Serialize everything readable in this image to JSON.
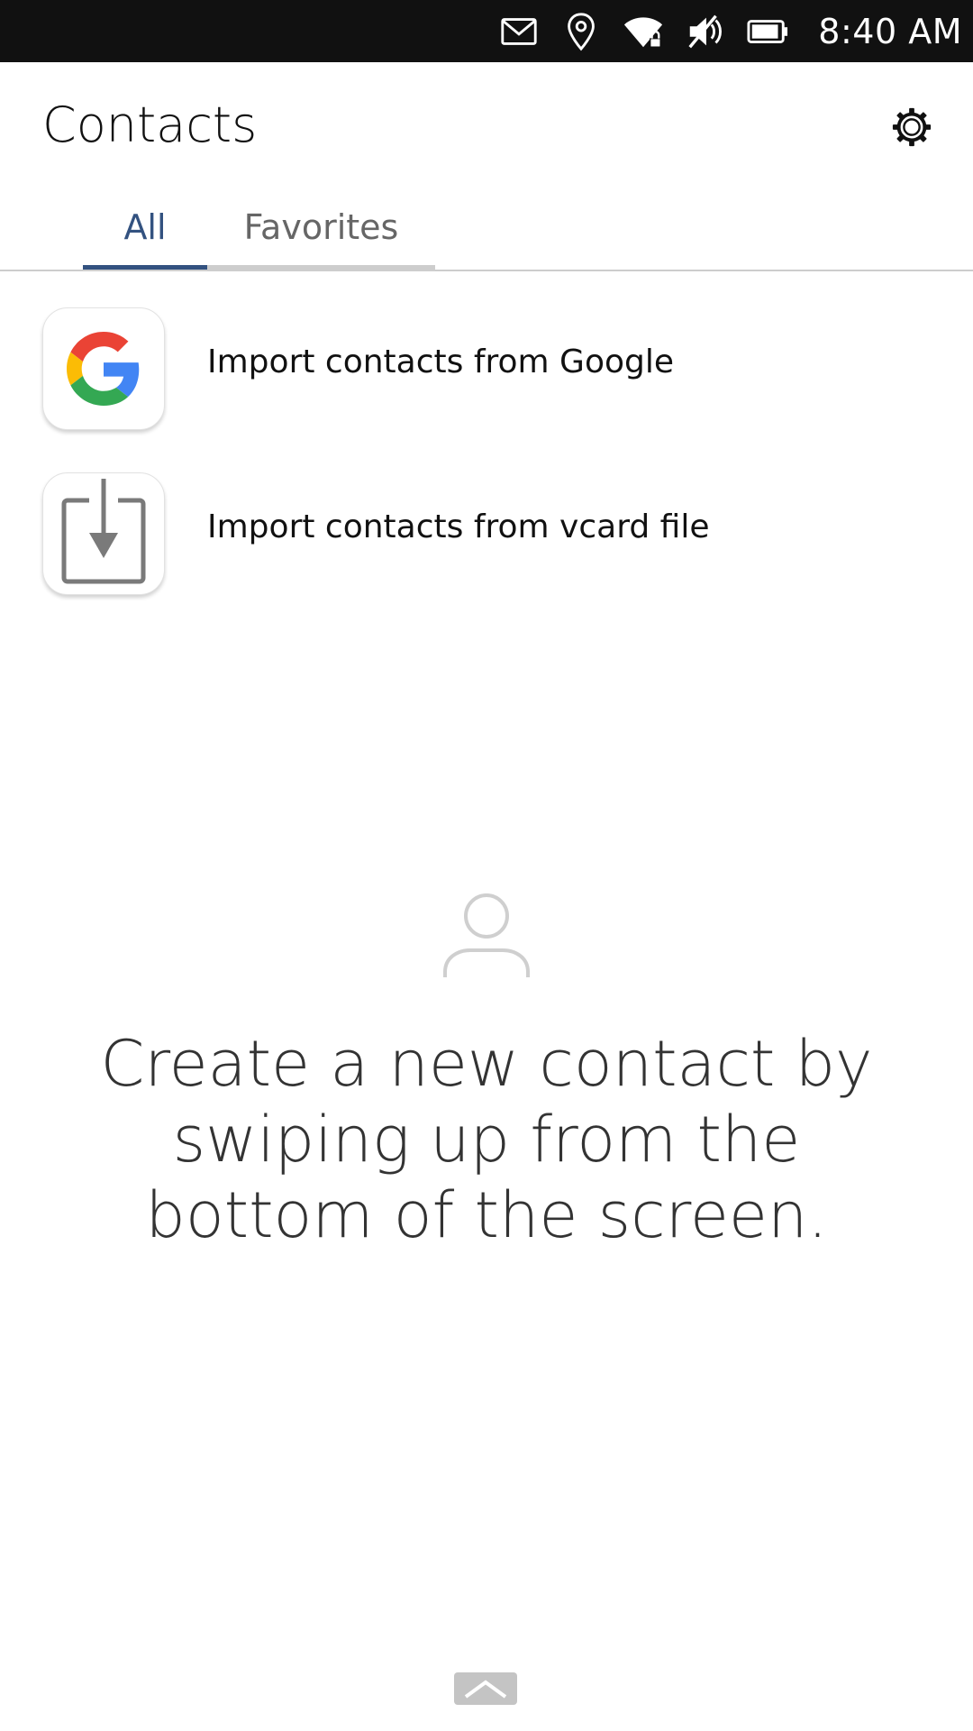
{
  "status_bar": {
    "time": "8:40 AM",
    "icons": [
      "message-icon",
      "location-icon",
      "wifi-locked-icon",
      "sound-muted-icon",
      "battery-icon"
    ]
  },
  "header": {
    "title": "Contacts",
    "settings_icon": "gear-icon"
  },
  "tabs": [
    {
      "label": "All",
      "active": true
    },
    {
      "label": "Favorites",
      "active": false
    }
  ],
  "import_options": [
    {
      "label": "Import contacts from Google",
      "icon": "google-icon"
    },
    {
      "label": "Import contacts from vcard file",
      "icon": "import-file-icon"
    }
  ],
  "empty_state": {
    "icon": "contact-avatar-icon",
    "message": "Create a new contact by swiping up from the bottom of the screen."
  },
  "bottom_edge": {
    "icon": "chevron-up-icon"
  },
  "colors": {
    "status_bar_bg": "#111111",
    "accent": "#335280",
    "inactive_tab": "#666666"
  }
}
